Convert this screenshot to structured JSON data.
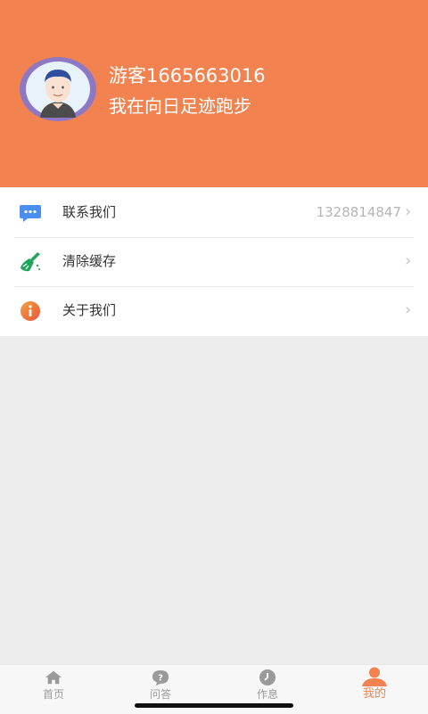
{
  "profile": {
    "username": "游客1665663016",
    "subtitle": "我在向日足迹跑步"
  },
  "menu": {
    "items": [
      {
        "label": "联系我们",
        "value": "1328814847",
        "icon": "chat-bubble-icon",
        "color": "#4a8ef0"
      },
      {
        "label": "清除缓存",
        "value": "",
        "icon": "broom-icon",
        "color": "#1fa65a"
      },
      {
        "label": "关于我们",
        "value": "",
        "icon": "info-icon",
        "color": "#f0723b"
      }
    ]
  },
  "tabbar": {
    "tabs": [
      {
        "label": "首页",
        "icon": "home-icon"
      },
      {
        "label": "问答",
        "icon": "question-icon"
      },
      {
        "label": "作息",
        "icon": "clock-icon"
      },
      {
        "label": "我的",
        "icon": "person-icon"
      }
    ],
    "active_color": "#f28350"
  },
  "colors": {
    "header": "#f28350",
    "background": "#ededed"
  }
}
